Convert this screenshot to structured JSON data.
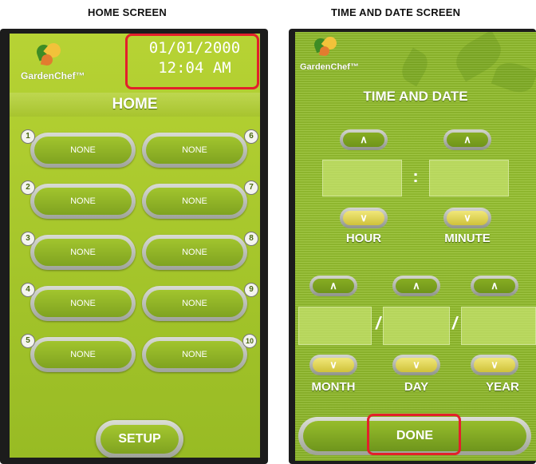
{
  "captions": {
    "left": "HOME SCREEN",
    "right": "TIME AND DATE SCREEN"
  },
  "home": {
    "logo_text": "GardenChef™",
    "clock_date": "01/01/2000",
    "clock_time": "12:04 AM",
    "title": "HOME",
    "slots": [
      {
        "number": "1",
        "label": "NONE"
      },
      {
        "number": "2",
        "label": "NONE"
      },
      {
        "number": "3",
        "label": "NONE"
      },
      {
        "number": "4",
        "label": "NONE"
      },
      {
        "number": "5",
        "label": "NONE"
      },
      {
        "number": "6",
        "label": "NONE"
      },
      {
        "number": "7",
        "label": "NONE"
      },
      {
        "number": "8",
        "label": "NONE"
      },
      {
        "number": "9",
        "label": "NONE"
      },
      {
        "number": "10",
        "label": "NONE"
      }
    ],
    "setup_label": "SETUP"
  },
  "timedate": {
    "logo_text": "GardenChef™",
    "title": "TIME AND DATE",
    "up_symbol": "∧",
    "down_symbol": "∨",
    "time_separator": ":",
    "date_separator": "/",
    "labels": {
      "hour": "HOUR",
      "minute": "MINUTE",
      "month": "MONTH",
      "day": "DAY",
      "year": "YEAR"
    },
    "done_label": "DONE"
  },
  "colors": {
    "highlight": "#e3202b",
    "screen_green": "#a3c42a"
  }
}
